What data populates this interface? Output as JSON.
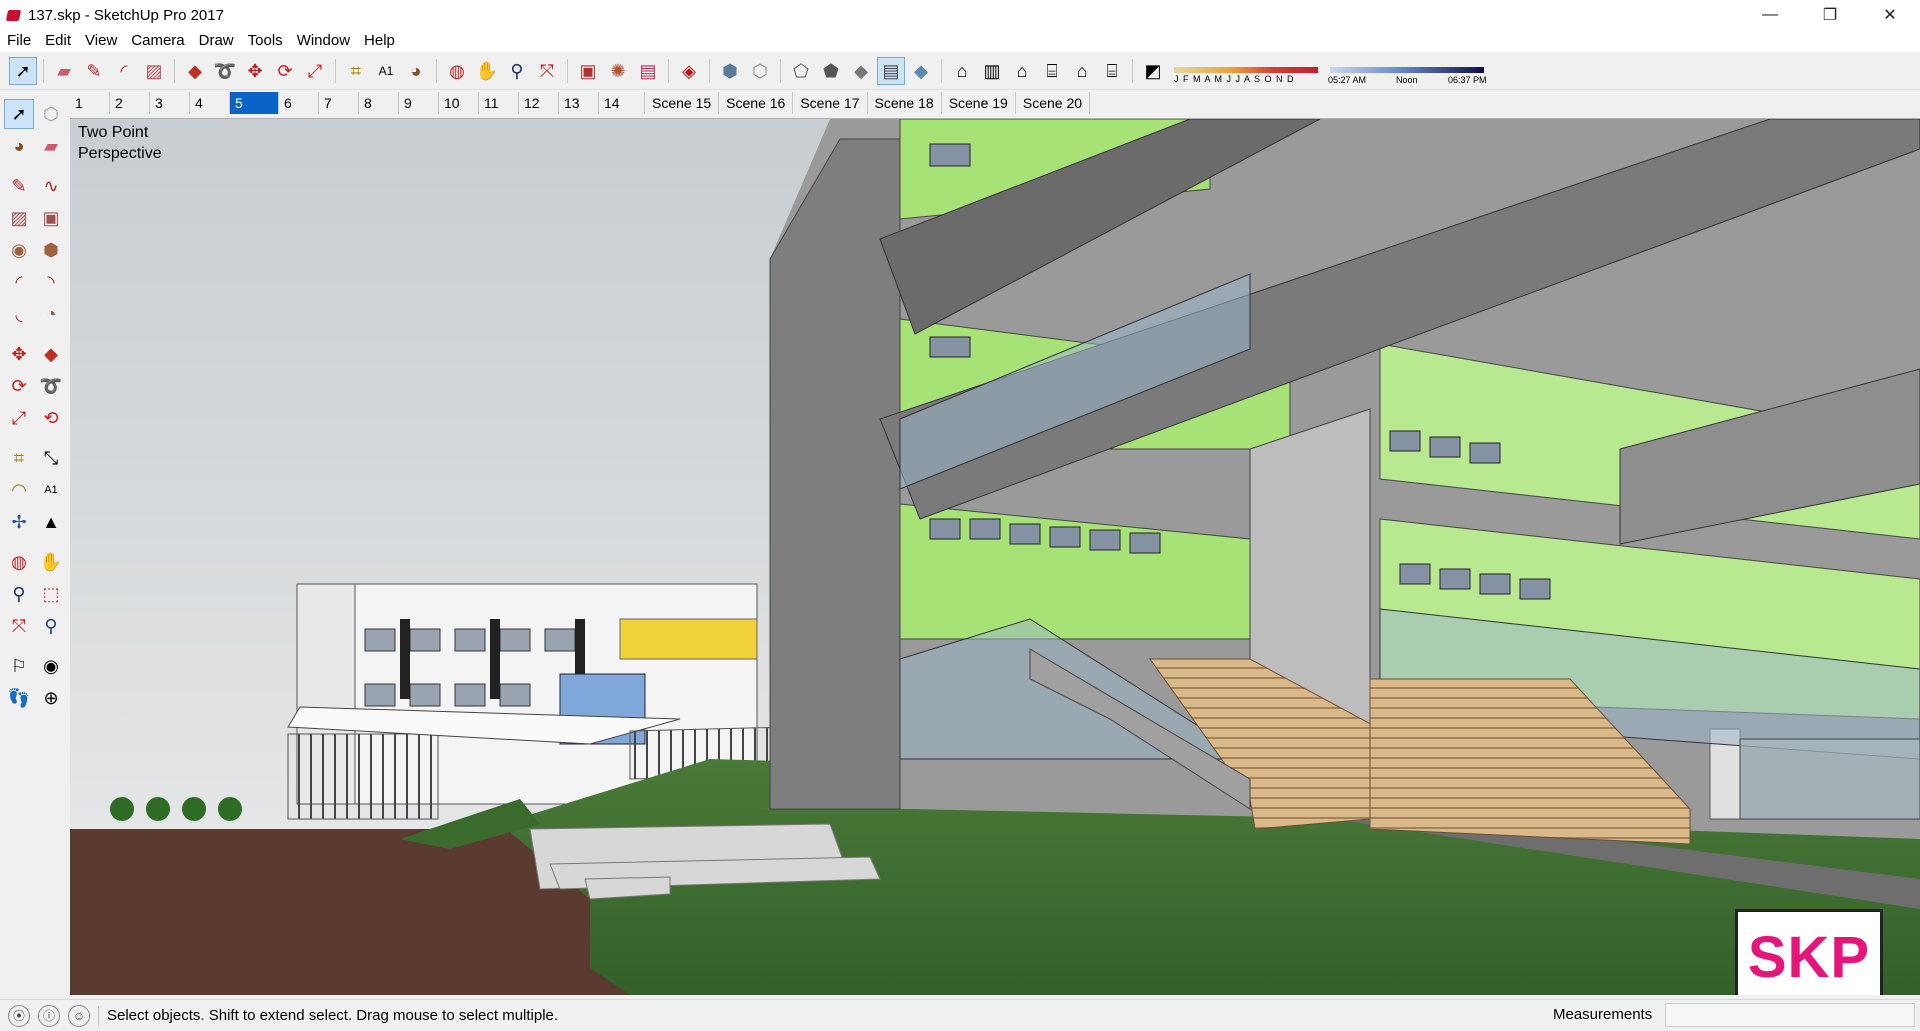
{
  "window": {
    "title": "137.skp - SketchUp Pro 2017",
    "controls": [
      "—",
      "❐",
      "✕"
    ]
  },
  "menu": [
    "File",
    "Edit",
    "View",
    "Camera",
    "Draw",
    "Tools",
    "Window",
    "Help"
  ],
  "shadow": {
    "months": "J F M A M J J A S O N D",
    "times": [
      "05:27 AM",
      "Noon",
      "06:37 PM"
    ]
  },
  "scenes": {
    "tabs": [
      "1",
      "2",
      "3",
      "4",
      "5",
      "6",
      "7",
      "8",
      "9",
      "10",
      "11",
      "12",
      "13",
      "14",
      "Scene 15",
      "Scene 16",
      "Scene 17",
      "Scene 18",
      "Scene 19",
      "Scene 20"
    ],
    "active_index": 4
  },
  "viewport": {
    "camera_label_line1": "Two Point",
    "camera_label_line2": "Perspective",
    "badge_text": "SKP"
  },
  "status": {
    "message": "Select objects. Shift to extend select. Drag mouse to select multiple.",
    "measurements_label": "Measurements",
    "measurements_value": ""
  },
  "colors": {
    "sky_top": "#c7cdd1",
    "sky_bottom": "#ebebeb",
    "grass": "#3d6b2c",
    "brick_path": "#5b3a30",
    "accent_green": "#a6e276",
    "concrete": "#8a8a8a",
    "badge_pink": "#e6157a",
    "active_blue": "#0a64c8"
  }
}
